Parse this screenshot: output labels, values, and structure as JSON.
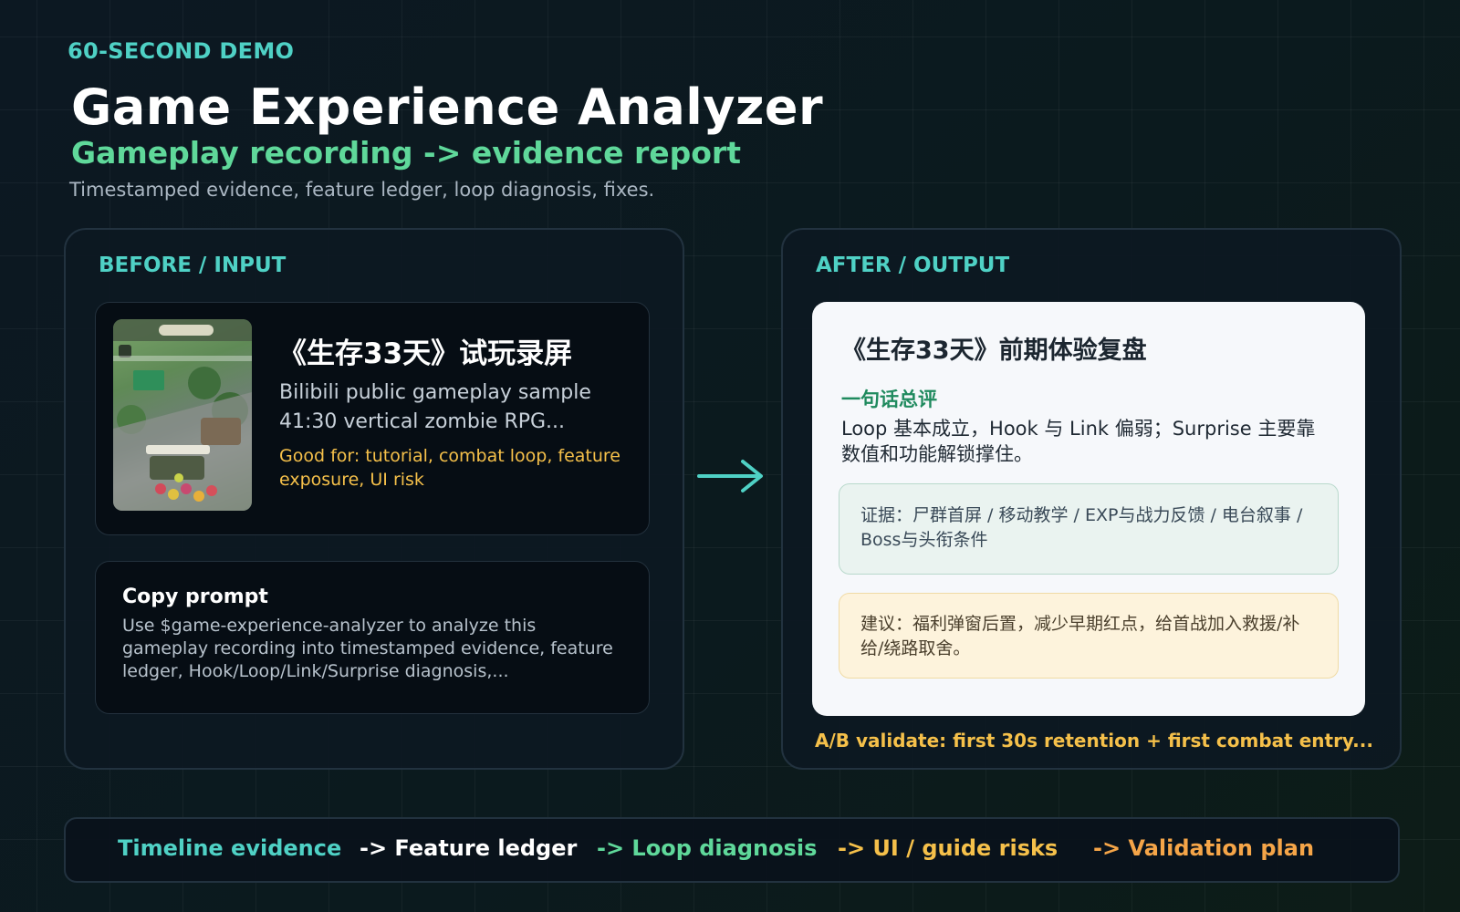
{
  "header": {
    "eyebrow": "60-SECOND DEMO",
    "title": "Game Experience Analyzer",
    "subtitle": "Gameplay recording -> evidence report",
    "description": "Timestamped evidence, feature ledger, loop diagnosis, fixes."
  },
  "input_panel": {
    "label": "BEFORE / INPUT",
    "recording": {
      "title": "《生存33天》试玩录屏",
      "subtitle": "Bilibili public gameplay sample 41:30 vertical zombie RPG...",
      "good_for": "Good for: tutorial, combat loop, feature exposure, UI risk"
    },
    "prompt": {
      "title": "Copy prompt",
      "body": "Use $game-experience-analyzer to analyze this gameplay recording into timestamped evidence, feature ledger, Hook/Loop/Link/Surprise diagnosis,..."
    }
  },
  "output_panel": {
    "label": "AFTER / OUTPUT",
    "report": {
      "title": "《生存33天》前期体验复盘",
      "summary_label": "一句话总评",
      "summary_text": "Loop 基本成立，Hook 与 Link 偏弱；Surprise 主要靠数值和功能解锁撑住。",
      "evidence": "证据：尸群首屏 / 移动教学 / EXP与战力反馈 / 电台叙事 / Boss与头衔条件",
      "advice": "建议：福利弹窗后置，减少早期红点，给首战加入救援/补给/绕路取舍。"
    },
    "ab_validate": "A/B validate: first 30s retention + first combat entry..."
  },
  "pipeline": {
    "steps": [
      {
        "label": "Timeline evidence",
        "color": "#4fd1c5"
      },
      {
        "label": "-> Feature ledger",
        "color": "#ffffff"
      },
      {
        "label": "-> Loop diagnosis",
        "color": "#5fd89a"
      },
      {
        "label": "-> UI / guide risks",
        "color": "#f5c04a"
      },
      {
        "label": "-> Validation plan",
        "color": "#f5a548"
      }
    ]
  },
  "colors": {
    "accent_teal": "#4fd1c5",
    "accent_green": "#5fd89a",
    "accent_yellow": "#f5c04a",
    "accent_orange": "#f5a548"
  },
  "icons": {
    "arrow": "arrow-right-icon",
    "thumbnail": "gameplay-thumbnail"
  }
}
